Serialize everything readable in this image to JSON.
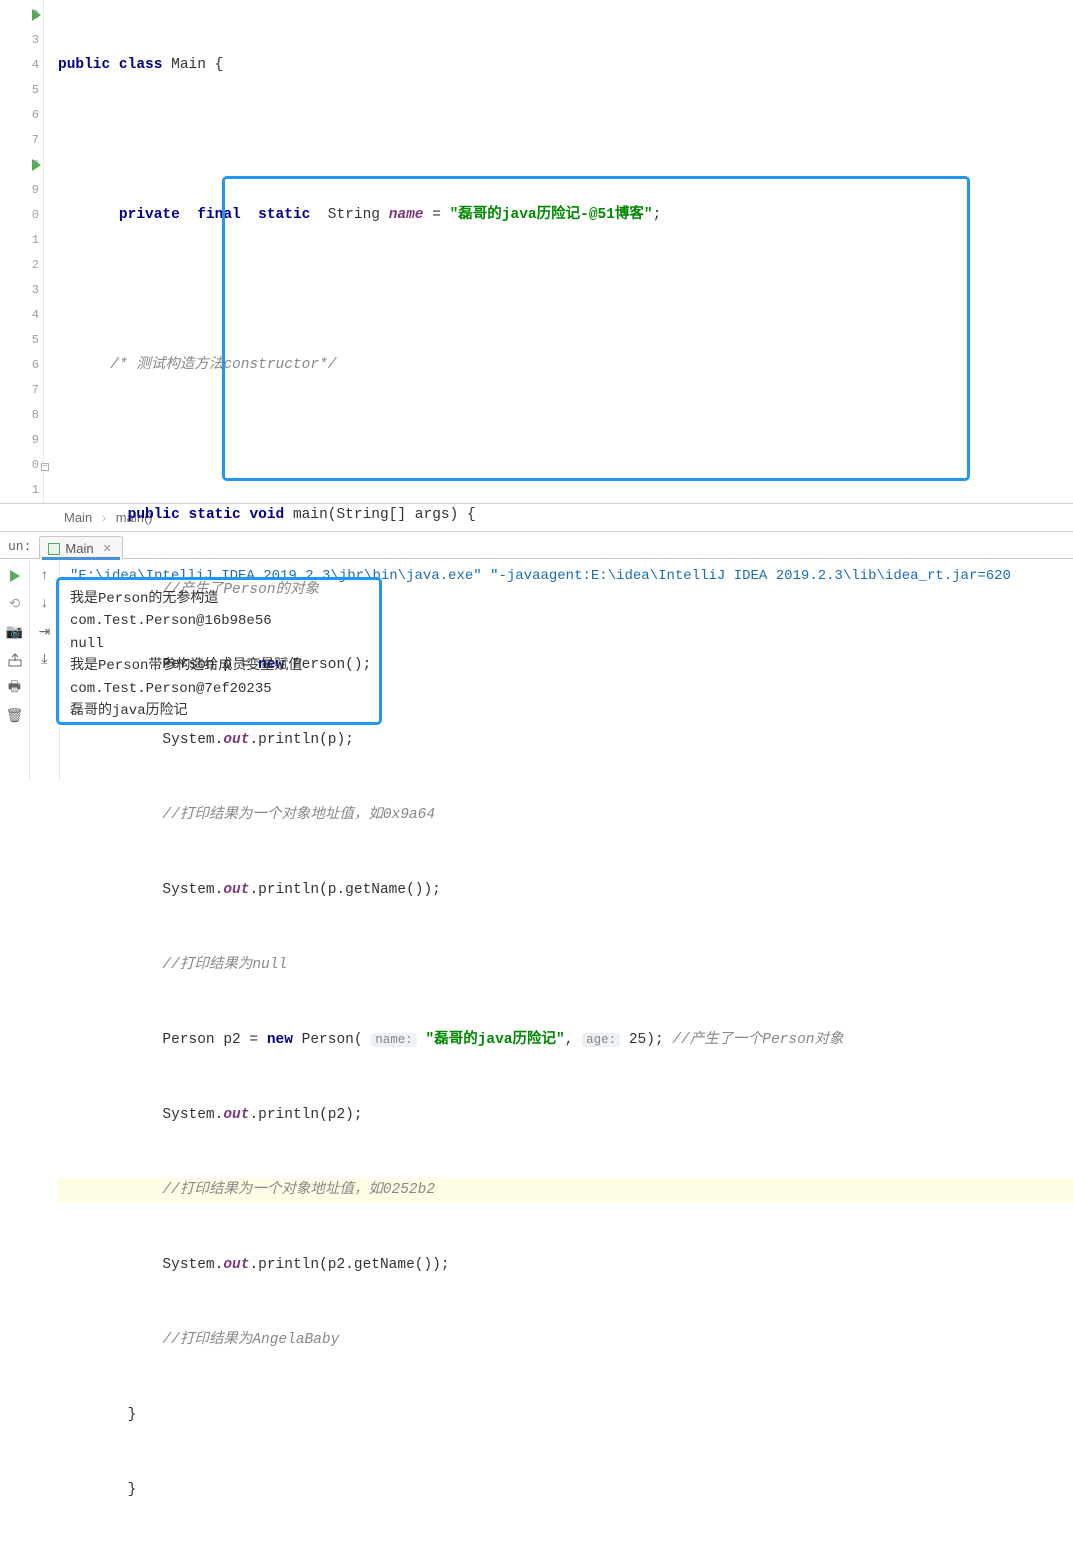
{
  "gutter": [
    "2",
    "3",
    "4",
    "5",
    "6",
    "7",
    "8",
    "9",
    "0",
    "1",
    "2",
    "3",
    "4",
    "5",
    "6",
    "7",
    "8",
    "9",
    "0",
    "1"
  ],
  "code": {
    "l1": {
      "kw": "public class",
      "rest": " Main {"
    },
    "l3_a": "private  final  static",
    "l3_b": "  String ",
    "l3_name": "name",
    "l3_c": " = ",
    "l3_str": "\"磊哥的java历险记-@51博客\"",
    "l3_d": ";",
    "l5": "/* 测试构造方法constructor*/",
    "l7_a": "public static void",
    "l7_b": " main(String[] args) {",
    "l8": "//产生了Person的对象",
    "l9_a": "Person p = ",
    "l9_new": "new",
    "l9_b": " Person();",
    "l10_a": "System.",
    "l10_out": "out",
    "l10_b": ".println(p);",
    "l11": "//打印结果为一个对象地址值，如0x9a64",
    "l12_a": "System.",
    "l12_out": "out",
    "l12_b": ".println(p.getName());",
    "l13": "//打印结果为null",
    "l14_a": "Person p2 = ",
    "l14_new": "new",
    "l14_b": " Person( ",
    "l14_h1": "name:",
    "l14_str": " \"磊哥的java历险记\"",
    "l14_c": ", ",
    "l14_h2": "age:",
    "l14_d": " 25); ",
    "l14_cm": "//产生了一个Person对象",
    "l15_a": "System.",
    "l15_out": "out",
    "l15_b": ".println(p2);",
    "l16": "//打印结果为一个对象地址值，如0252b2",
    "l17_a": "System.",
    "l17_out": "out",
    "l17_b": ".println(p2.getName());",
    "l18": "//打印结果为AngelaBaby",
    "brace": "}"
  },
  "breadcrumb": {
    "a": "Main",
    "b": "main()"
  },
  "run": {
    "label": "un:",
    "tab": "Main"
  },
  "console": {
    "cmd": "\"E:\\idea\\IntelliJ IDEA 2019.2.3\\jbr\\bin\\java.exe\" \"-javaagent:E:\\idea\\IntelliJ IDEA 2019.2.3\\lib\\idea_rt.jar=620",
    "l1": "我是Person的无参构造",
    "l2": "com.Test.Person@16b98e56",
    "l3": "null",
    "l4": "我是Person带参构造给成员变量赋值",
    "l5": "com.Test.Person@7ef20235",
    "l6": "磊哥的java历险记"
  }
}
